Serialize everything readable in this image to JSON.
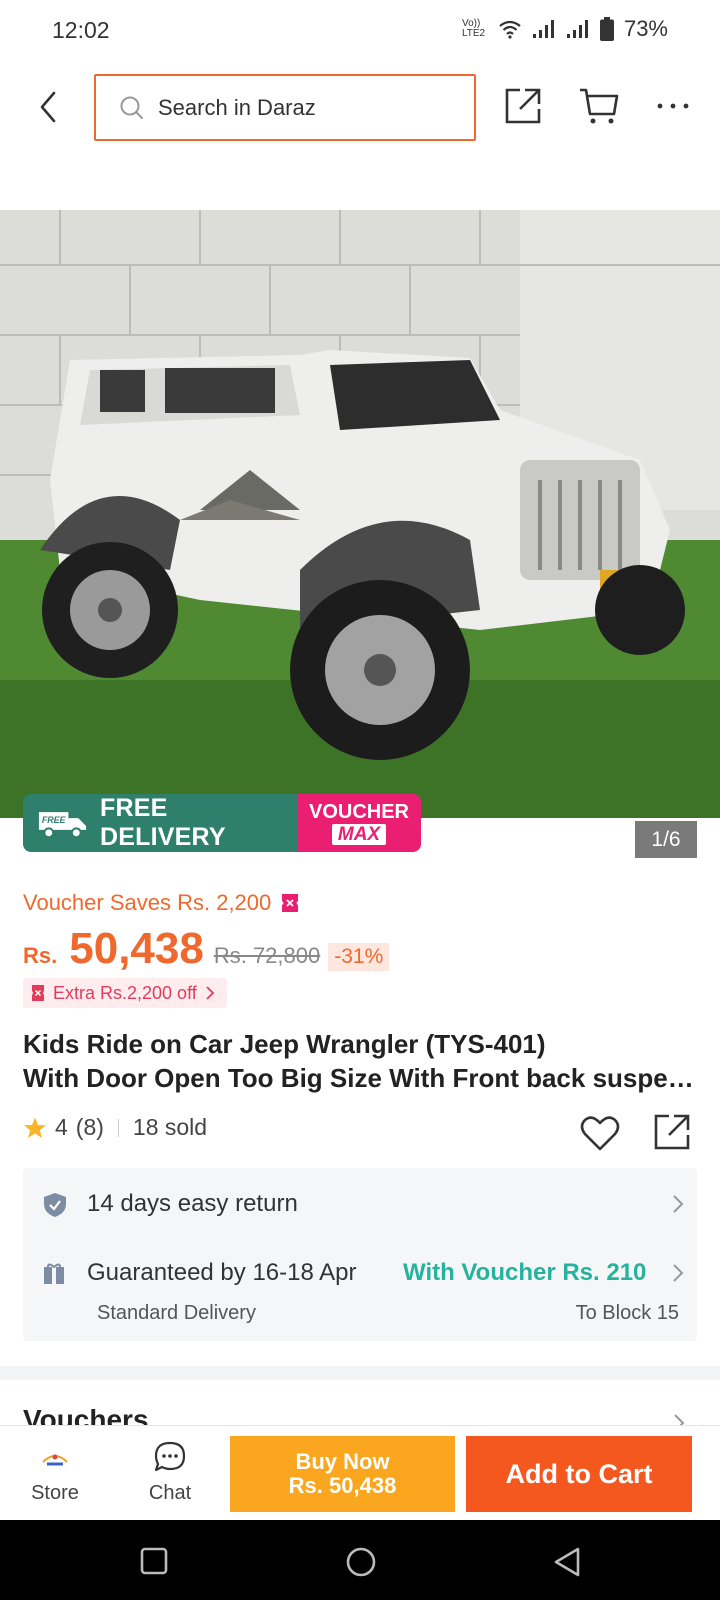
{
  "status_bar": {
    "time": "12:02",
    "network_label": "Vo)) LTE2",
    "battery": "73%"
  },
  "top_nav": {
    "search_placeholder": "Search in Daraz"
  },
  "hero": {
    "free_delivery": "FREE DELIVERY",
    "free_tag": "FREE",
    "voucher_line1": "VOUCHER",
    "voucher_line2": "MAX",
    "pager": "1/6"
  },
  "price": {
    "voucher_saves": "Voucher Saves Rs. 2,200",
    "currency": "Rs.",
    "value": "50,438",
    "old_price": "Rs. 72,800",
    "discount": "-31%",
    "extra_off": "Extra Rs.2,200 off"
  },
  "product": {
    "title_line1": "Kids Ride on Car Jeep Wrangler (TYS-401)",
    "title_line2": "With Door Open Too Big Size With Front back suspension",
    "rating": "4",
    "reviews": "(8)",
    "sold": "18 sold"
  },
  "delivery": {
    "return_text": "14 days easy return",
    "guarantee_text": "Guaranteed by 16-18 Apr",
    "voucher_text": "With Voucher Rs. 210",
    "delivery_type": "Standard Delivery",
    "destination": "To Block 15"
  },
  "sections": {
    "vouchers": "Vouchers"
  },
  "bottom_bar": {
    "store_label": "Store",
    "chat_label": "Chat",
    "buy_now_line1": "Buy Now",
    "buy_now_line2": "Rs. 50,438",
    "add_to_cart": "Add to Cart"
  },
  "colors": {
    "accent_orange": "#f5581f",
    "buy_now": "#faa61e",
    "voucher_teal": "#25b39e",
    "free_delivery_green": "#2e7f6b",
    "voucher_max_pink": "#ea1f71"
  }
}
